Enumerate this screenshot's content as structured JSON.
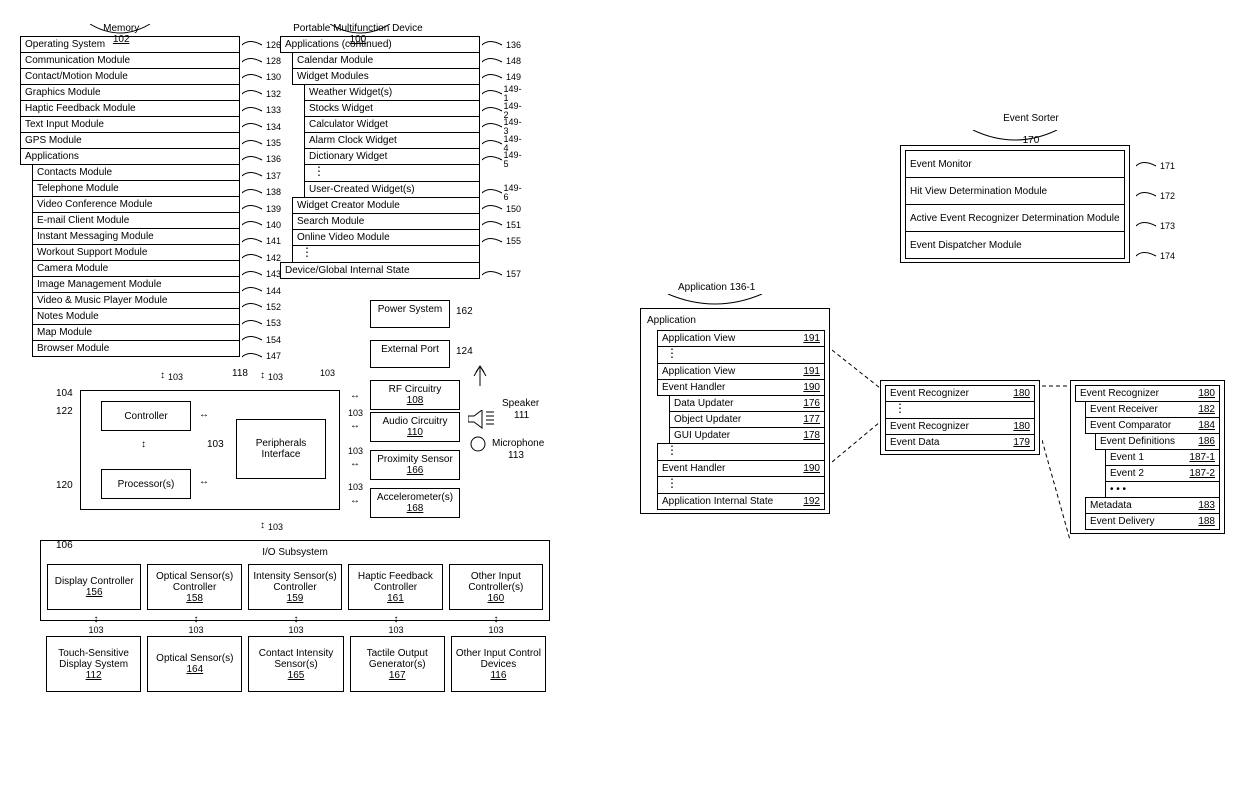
{
  "headers": {
    "memory": "Memory",
    "memory_ref": "102",
    "device": "Portable Multifunction Device",
    "device_ref": "100",
    "event_sorter": "Event Sorter",
    "event_sorter_ref": "170",
    "application_head": "Application 136-1"
  },
  "memory_items": [
    {
      "label": "Operating System",
      "ref": "126"
    },
    {
      "label": "Communication Module",
      "ref": "128"
    },
    {
      "label": "Contact/Motion Module",
      "ref": "130"
    },
    {
      "label": "Graphics Module",
      "ref": "132"
    },
    {
      "label": "Haptic Feedback Module",
      "ref": "133"
    },
    {
      "label": "Text Input Module",
      "ref": "134"
    },
    {
      "label": "GPS Module",
      "ref": "135"
    },
    {
      "label": "Applications",
      "ref": "136"
    },
    {
      "label": "Contacts Module",
      "ref": "137",
      "indent": 1
    },
    {
      "label": "Telephone Module",
      "ref": "138",
      "indent": 1
    },
    {
      "label": "Video Conference Module",
      "ref": "139",
      "indent": 1
    },
    {
      "label": "E-mail Client Module",
      "ref": "140",
      "indent": 1
    },
    {
      "label": "Instant Messaging Module",
      "ref": "141",
      "indent": 1
    },
    {
      "label": "Workout Support Module",
      "ref": "142",
      "indent": 1
    },
    {
      "label": "Camera Module",
      "ref": "143",
      "indent": 1
    },
    {
      "label": "Image Management Module",
      "ref": "144",
      "indent": 1
    },
    {
      "label": "Video & Music Player Module",
      "ref": "152",
      "indent": 1
    },
    {
      "label": "Notes Module",
      "ref": "153",
      "indent": 1
    },
    {
      "label": "Map Module",
      "ref": "154",
      "indent": 1
    },
    {
      "label": "Browser Module",
      "ref": "147",
      "indent": 1
    }
  ],
  "apps2_items": [
    {
      "label": "Applications (continued)",
      "ref": "136"
    },
    {
      "label": "Calendar Module",
      "ref": "148",
      "indent": 1
    },
    {
      "label": "Widget Modules",
      "ref": "149",
      "indent": 1
    },
    {
      "label": "Weather Widget(s)",
      "ref": "149-1",
      "indent": 2
    },
    {
      "label": "Stocks Widget",
      "ref": "149-2",
      "indent": 2
    },
    {
      "label": "Calculator Widget",
      "ref": "149-3",
      "indent": 2
    },
    {
      "label": "Alarm Clock Widget",
      "ref": "149-4",
      "indent": 2
    },
    {
      "label": "Dictionary Widget",
      "ref": "149-5",
      "indent": 2
    },
    {
      "label": "⋮",
      "ref": "",
      "indent": 2,
      "dots": true
    },
    {
      "label": "User-Created Widget(s)",
      "ref": "149-6",
      "indent": 2
    },
    {
      "label": "Widget Creator Module",
      "ref": "150",
      "indent": 1
    },
    {
      "label": "Search Module",
      "ref": "151",
      "indent": 1
    },
    {
      "label": "Online Video Module",
      "ref": "155",
      "indent": 1
    },
    {
      "label": "⋮",
      "ref": "",
      "indent": 1,
      "dots": true
    },
    {
      "label": "Device/Global Internal State",
      "ref": "157"
    }
  ],
  "hw": {
    "power": {
      "label": "Power System",
      "ref": "162"
    },
    "ext_port": {
      "label": "External Port",
      "ref": "124"
    },
    "controller": {
      "label": "Controller",
      "ref": ""
    },
    "processors": {
      "label": "Processor(s)",
      "ref": ""
    },
    "periph": {
      "label": "Peripherals Interface",
      "ref": ""
    },
    "rf": {
      "label": "RF Circuitry",
      "ref": "108"
    },
    "audio": {
      "label": "Audio Circuitry",
      "ref": "110"
    },
    "prox": {
      "label": "Proximity Sensor",
      "ref": "166"
    },
    "accel": {
      "label": "Accelerometer(s)",
      "ref": "168"
    },
    "speaker": {
      "label": "Speaker",
      "ref": "111"
    },
    "mic": {
      "label": "Microphone",
      "ref": "113"
    },
    "refs": {
      "left104": "104",
      "left122": "122",
      "left120": "120",
      "left106": "106",
      "ref118": "118",
      "bus103": "103"
    },
    "io": {
      "label": "I/O Subsystem"
    },
    "io_row1": [
      {
        "label": "Display Controller",
        "ref": "156"
      },
      {
        "label": "Optical Sensor(s) Controller",
        "ref": "158"
      },
      {
        "label": "Intensity Sensor(s) Controller",
        "ref": "159"
      },
      {
        "label": "Haptic Feedback Controller",
        "ref": "161"
      },
      {
        "label": "Other Input Controller(s)",
        "ref": "160"
      }
    ],
    "io_row2": [
      {
        "label": "Touch-Sensitive Display System",
        "ref": "112"
      },
      {
        "label": "Optical Sensor(s)",
        "ref": "164"
      },
      {
        "label": "Contact Intensity Sensor(s)",
        "ref": "165"
      },
      {
        "label": "Tactile Output Generator(s)",
        "ref": "167"
      },
      {
        "label": "Other Input Control Devices",
        "ref": "116"
      }
    ]
  },
  "app_struct": {
    "title": "Application",
    "rows": [
      {
        "label": "Application View",
        "ref": "191",
        "indent": 1
      },
      {
        "label": "⋮",
        "dots": true,
        "indent": 1
      },
      {
        "label": "Application View",
        "ref": "191",
        "indent": 1
      },
      {
        "label": "Event Handler",
        "ref": "190",
        "indent": 1
      },
      {
        "label": "Data Updater",
        "ref": "176",
        "indent": 2
      },
      {
        "label": "Object Updater",
        "ref": "177",
        "indent": 2
      },
      {
        "label": "GUI Updater",
        "ref": "178",
        "indent": 2
      },
      {
        "label": "⋮",
        "dots": true,
        "indent": 1
      },
      {
        "label": "Event Handler",
        "ref": "190",
        "indent": 1
      },
      {
        "label": "⋮",
        "dots": true,
        "indent": 1
      },
      {
        "label": "Application Internal State",
        "ref": "192",
        "indent": 1
      }
    ]
  },
  "event_rec_small": {
    "rows": [
      {
        "label": "Event Recognizer",
        "ref": "180"
      },
      {
        "label": "⋮",
        "dots": true
      },
      {
        "label": "Event Recognizer",
        "ref": "180"
      },
      {
        "label": "Event Data",
        "ref": "179"
      }
    ]
  },
  "event_rec_big": {
    "rows": [
      {
        "label": "Event Recognizer",
        "ref": "180"
      },
      {
        "label": "Event Receiver",
        "ref": "182",
        "indent": 1
      },
      {
        "label": "Event Comparator",
        "ref": "184",
        "indent": 1
      },
      {
        "label": "Event Definitions",
        "ref": "186",
        "indent": 2
      },
      {
        "label": "Event 1",
        "ref": "187-1",
        "indent": 3
      },
      {
        "label": "Event 2",
        "ref": "187-2",
        "indent": 3
      },
      {
        "label": "• • •",
        "dots": true,
        "indent": 3
      },
      {
        "label": "Metadata",
        "ref": "183",
        "indent": 1
      },
      {
        "label": "Event Delivery",
        "ref": "188",
        "indent": 1
      }
    ]
  },
  "event_sorter": {
    "rows": [
      {
        "label": "Event Monitor",
        "ref": "171"
      },
      {
        "label": "Hit View Determination Module",
        "ref": "172"
      },
      {
        "label": "Active Event Recognizer Determination Module",
        "ref": "173"
      },
      {
        "label": "Event Dispatcher Module",
        "ref": "174"
      }
    ]
  }
}
